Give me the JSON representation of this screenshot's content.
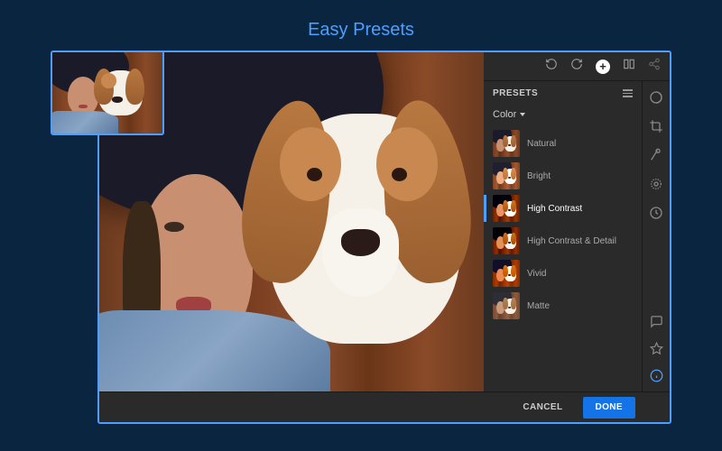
{
  "page": {
    "title": "Easy Presets"
  },
  "panel": {
    "title": "PRESETS",
    "category": "Color"
  },
  "presets": [
    {
      "label": "Natural",
      "selected": false
    },
    {
      "label": "Bright",
      "selected": false
    },
    {
      "label": "High Contrast",
      "selected": true
    },
    {
      "label": "High Contrast & Detail",
      "selected": false
    },
    {
      "label": "Vivid",
      "selected": false
    },
    {
      "label": "Matte",
      "selected": false
    }
  ],
  "footer": {
    "cancel": "CANCEL",
    "done": "DONE"
  }
}
